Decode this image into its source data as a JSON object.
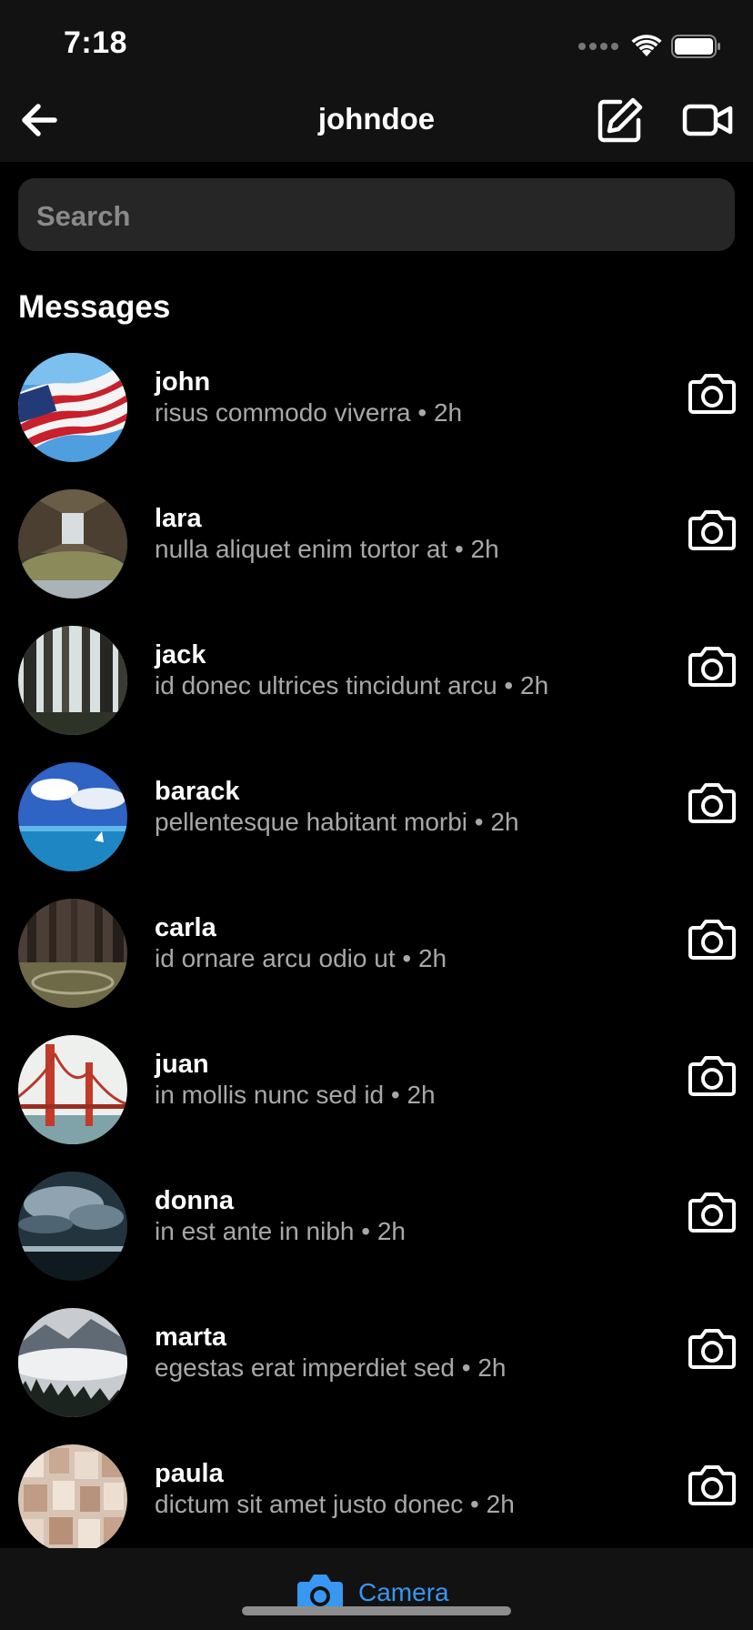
{
  "status_bar": {
    "time": "7:18",
    "icons": [
      "signal-dots-icon",
      "wifi-icon",
      "battery-icon"
    ]
  },
  "nav": {
    "title": "johndoe",
    "back_icon": "arrow-left-icon",
    "compose_icon": "compose-icon",
    "video_icon": "video-camera-icon"
  },
  "search": {
    "placeholder": "Search"
  },
  "section_title": "Messages",
  "threads": [
    {
      "name": "john",
      "preview": "risus commodo viverra • 2h",
      "avatar": "american-flag"
    },
    {
      "name": "lara",
      "preview": "nulla aliquet enim tortor at • 2h",
      "avatar": "pier"
    },
    {
      "name": "jack",
      "preview": "id donec ultrices tincidunt arcu • 2h",
      "avatar": "forest"
    },
    {
      "name": "barack",
      "preview": "pellentesque habitant morbi • 2h",
      "avatar": "ocean"
    },
    {
      "name": "carla",
      "preview": "id ornare arcu odio ut • 2h",
      "avatar": "woods-path"
    },
    {
      "name": "juan",
      "preview": "in mollis nunc sed id • 2h",
      "avatar": "golden-gate-bridge"
    },
    {
      "name": "donna",
      "preview": "in est ante in nibh • 2h",
      "avatar": "stormy-sky"
    },
    {
      "name": "marta",
      "preview": "egestas erat imperdiet sed • 2h",
      "avatar": "misty-mountains"
    },
    {
      "name": "paula",
      "preview": "dictum sit amet justo donec • 2h",
      "avatar": "book-pages"
    }
  ],
  "bottom_bar": {
    "label": "Camera",
    "icon": "camera-icon"
  },
  "colors": {
    "accent": "#3897f0",
    "background": "#000000",
    "bar": "#121212",
    "secondary_text": "#a8a8a8"
  }
}
